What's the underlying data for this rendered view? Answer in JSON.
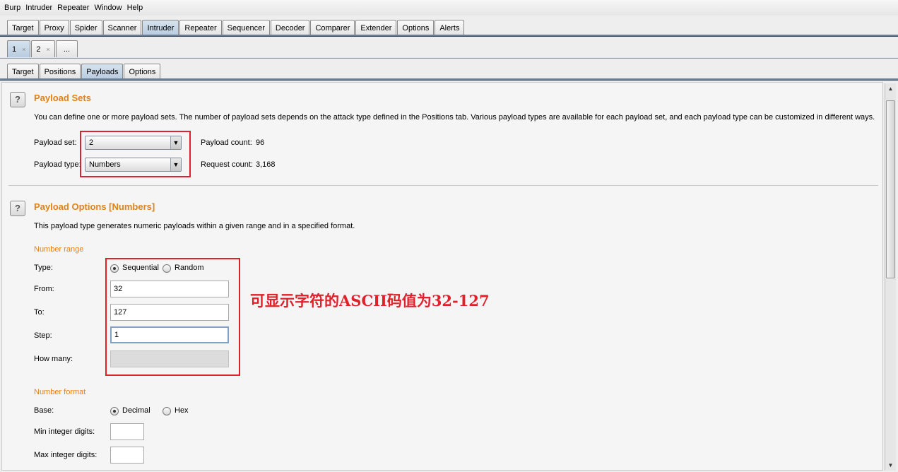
{
  "menu": [
    "Burp",
    "Intruder",
    "Repeater",
    "Window",
    "Help"
  ],
  "main_tabs": [
    "Target",
    "Proxy",
    "Spider",
    "Scanner",
    "Intruder",
    "Repeater",
    "Sequencer",
    "Decoder",
    "Comparer",
    "Extender",
    "Options",
    "Alerts"
  ],
  "attack_tabs": [
    {
      "label": "1",
      "close": "×"
    },
    {
      "label": "2",
      "close": "×"
    },
    {
      "label": "..."
    }
  ],
  "inner_tabs": [
    "Target",
    "Positions",
    "Payloads",
    "Options"
  ],
  "payload_sets": {
    "title": "Payload Sets",
    "description": "You can define one or more payload sets. The number of payload sets depends on the attack type defined in the Positions tab. Various payload types are available for each payload set, and each payload type can be customized in different ways.",
    "set_label": "Payload set:",
    "set_value": "2",
    "type_label": "Payload type:",
    "type_value": "Numbers",
    "count_label": "Payload count:",
    "count_value": "96",
    "request_label": "Request count:",
    "request_value": "3,168"
  },
  "payload_options": {
    "title": "Payload Options [Numbers]",
    "description": "This payload type generates numeric payloads within a given range and in a specified format.",
    "range_heading": "Number range",
    "type_label": "Type:",
    "sequential_label": "Sequential",
    "random_label": "Random",
    "from_label": "From:",
    "from_value": "32",
    "to_label": "To:",
    "to_value": "127",
    "step_label": "Step:",
    "step_value": "1",
    "howmany_label": "How many:",
    "howmany_value": "",
    "format_heading": "Number format",
    "base_label": "Base:",
    "decimal_label": "Decimal",
    "hex_label": "Hex",
    "min_int_label": "Min integer digits:",
    "max_int_label": "Max integer digits:"
  },
  "annotation": "可显示字符的ASCII码值为32-127",
  "help_glyph": "?",
  "dropdown_glyph": "▼",
  "scroll_up_glyph": "▲",
  "scroll_down_glyph": "▼",
  "colors": {
    "section_title": "#e0821a",
    "annotation": "#e0212b",
    "active_tab": "#c4d4e4"
  }
}
